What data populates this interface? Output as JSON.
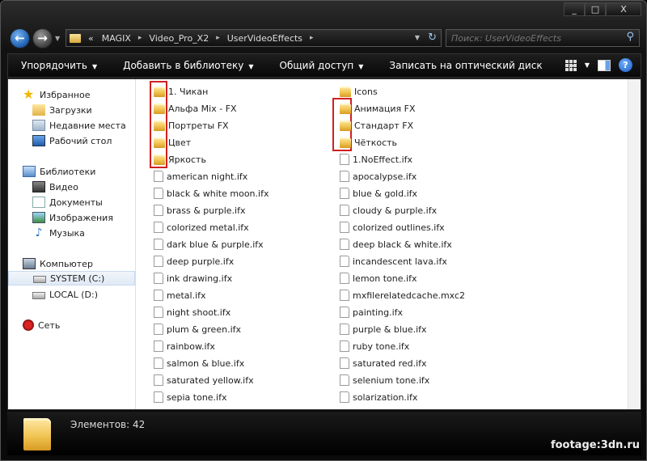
{
  "window": {
    "minimize_glyph": "_",
    "maximize_glyph": "□",
    "close_glyph": "X"
  },
  "address": {
    "overflow": "«",
    "crumbs": [
      "MAGIX",
      "Video_Pro_X2",
      "UserVideoEffects"
    ],
    "separator": "▸"
  },
  "search": {
    "placeholder": "Поиск: UserVideoEffects"
  },
  "toolbar": {
    "organize": "Упорядочить",
    "add_to_library": "Добавить в библиотеку",
    "share": "Общий доступ",
    "burn": "Записать на оптический диск",
    "more": "»",
    "help": "?"
  },
  "navpane": {
    "favorites": "Избранное",
    "downloads": "Загрузки",
    "recent": "Недавние места",
    "desktop": "Рабочий стол",
    "libraries": "Библиотеки",
    "video": "Видео",
    "documents": "Документы",
    "pictures": "Изображения",
    "music": "Музыка",
    "computer": "Компьютер",
    "drive_c": "SYSTEM (C:)",
    "drive_d": "LOCAL (D:)",
    "network": "Сеть"
  },
  "files": {
    "col1": [
      {
        "name": "1. Чикан",
        "type": "folder"
      },
      {
        "name": "Альфа  Mix - FX",
        "type": "folder"
      },
      {
        "name": "Портреты   FX",
        "type": "folder"
      },
      {
        "name": "Цвет",
        "type": "folder"
      },
      {
        "name": "Яркость",
        "type": "folder"
      },
      {
        "name": "american night.ifx",
        "type": "file"
      },
      {
        "name": "black & white moon.ifx",
        "type": "file"
      },
      {
        "name": "brass & purple.ifx",
        "type": "file"
      },
      {
        "name": "colorized metal.ifx",
        "type": "file"
      },
      {
        "name": "dark blue & purple.ifx",
        "type": "file"
      },
      {
        "name": "deep purple.ifx",
        "type": "file"
      },
      {
        "name": "ink drawing.ifx",
        "type": "file"
      },
      {
        "name": "metal.ifx",
        "type": "file"
      },
      {
        "name": "night shoot.ifx",
        "type": "file"
      },
      {
        "name": "plum & green.ifx",
        "type": "file"
      },
      {
        "name": "rainbow.ifx",
        "type": "file"
      },
      {
        "name": "salmon & blue.ifx",
        "type": "file"
      },
      {
        "name": "saturated yellow.ifx",
        "type": "file"
      },
      {
        "name": "sepia tone.ifx",
        "type": "file"
      }
    ],
    "col2": [
      {
        "name": "Icons",
        "type": "folder"
      },
      {
        "name": "Анимация  FX",
        "type": "folder"
      },
      {
        "name": "Стандарт  FX",
        "type": "folder"
      },
      {
        "name": "Чёткость",
        "type": "folder"
      },
      {
        "name": "1.NoEffect.ifx",
        "type": "file"
      },
      {
        "name": "apocalypse.ifx",
        "type": "file"
      },
      {
        "name": "blue & gold.ifx",
        "type": "file"
      },
      {
        "name": "cloudy & purple.ifx",
        "type": "file"
      },
      {
        "name": "colorized outlines.ifx",
        "type": "file"
      },
      {
        "name": "deep black & white.ifx",
        "type": "file"
      },
      {
        "name": "incandescent lava.ifx",
        "type": "file"
      },
      {
        "name": "lemon tone.ifx",
        "type": "file"
      },
      {
        "name": "mxfilerelatedcache.mxc2",
        "type": "file"
      },
      {
        "name": "painting.ifx",
        "type": "file"
      },
      {
        "name": "purple & blue.ifx",
        "type": "file"
      },
      {
        "name": "ruby tone.ifx",
        "type": "file"
      },
      {
        "name": "saturated red.ifx",
        "type": "file"
      },
      {
        "name": "selenium tone.ifx",
        "type": "file"
      },
      {
        "name": "solarization.ifx",
        "type": "file"
      }
    ]
  },
  "status": {
    "items": "Элементов: 42"
  },
  "watermark": "footage:3dn.ru",
  "colors": {
    "highlight_box": "#d21f1f",
    "folder": "#f0c554"
  }
}
